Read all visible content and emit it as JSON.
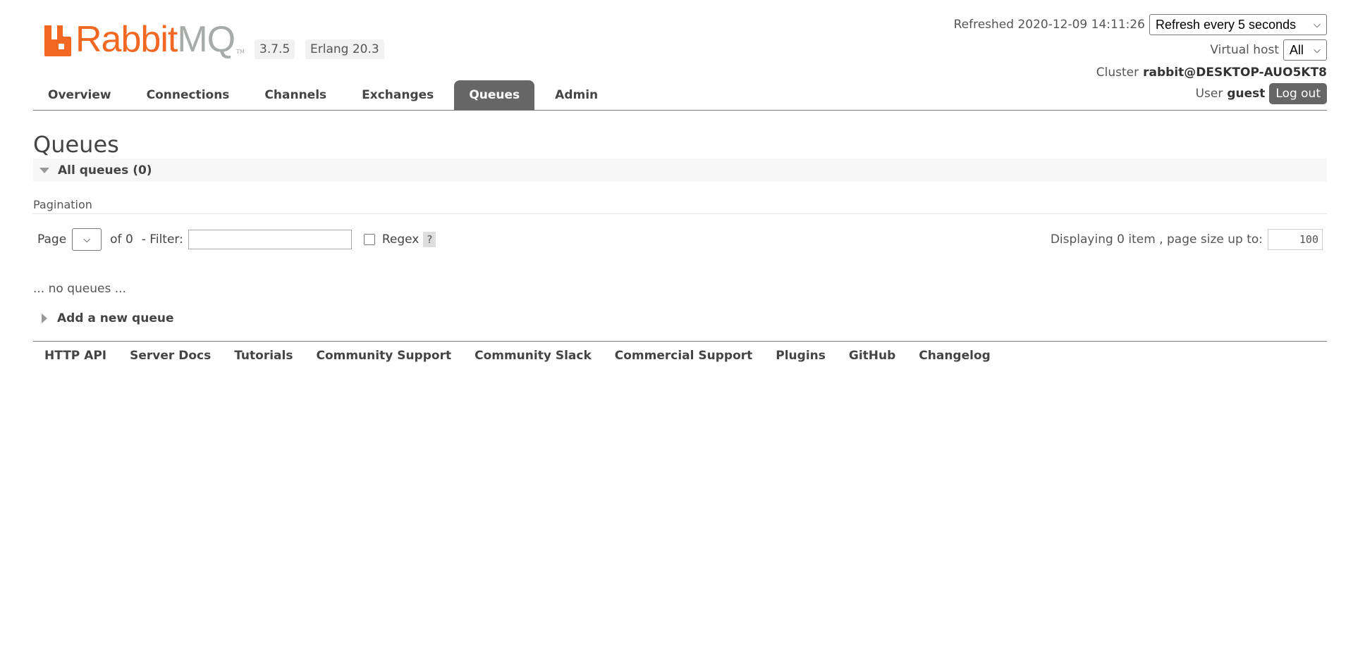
{
  "brand": {
    "name_primary": "Rabbit",
    "name_secondary": "MQ",
    "trademark": "TM",
    "orange": "#f26822",
    "gray": "#a7aca9"
  },
  "versions": {
    "rabbitmq": "3.7.5",
    "erlang": "Erlang 20.3"
  },
  "header": {
    "refreshed_label": "Refreshed 2020-12-09 14:11:26",
    "refresh_select": "Refresh every 5 seconds",
    "vhost_label": "Virtual host",
    "vhost_value": "All",
    "cluster_label": "Cluster",
    "cluster_name": "rabbit@DESKTOP-AUO5KT8",
    "user_label": "User",
    "user_name": "guest",
    "logout_label": "Log out"
  },
  "tabs": [
    {
      "label": "Overview",
      "active": false
    },
    {
      "label": "Connections",
      "active": false
    },
    {
      "label": "Channels",
      "active": false
    },
    {
      "label": "Exchanges",
      "active": false
    },
    {
      "label": "Queues",
      "active": true
    },
    {
      "label": "Admin",
      "active": false
    }
  ],
  "page": {
    "title": "Queues",
    "section_title": "All queues (0)",
    "pagination_label": "Pagination",
    "page_label": "Page",
    "of_label": "of 0",
    "filter_label": "- Filter:",
    "filter_value": "",
    "regex_label": "Regex",
    "regex_checked": false,
    "help_label": "?",
    "displaying_label": "Displaying 0 item , page size up to:",
    "page_size": "100",
    "empty_message": "... no queues ...",
    "add_queue_label": "Add a new queue"
  },
  "footer": {
    "links": [
      "HTTP API",
      "Server Docs",
      "Tutorials",
      "Community Support",
      "Community Slack",
      "Commercial Support",
      "Plugins",
      "GitHub",
      "Changelog"
    ]
  },
  "icons": {
    "expanded": "triangle-down-icon",
    "collapsed": "triangle-right-icon",
    "select": "chevron-down-icon",
    "logo": "rabbitmq-logo-icon"
  }
}
